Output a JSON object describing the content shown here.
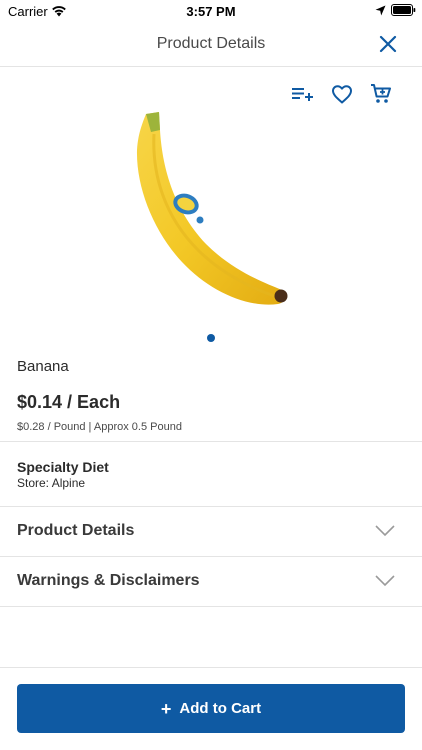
{
  "status_bar": {
    "carrier": "Carrier",
    "time": "3:57 PM"
  },
  "nav": {
    "title": "Product Details",
    "close_icon": "close-icon"
  },
  "actions": {
    "icons": [
      "playlist-add-icon",
      "heart-icon",
      "cart-icon"
    ]
  },
  "product": {
    "name": "Banana",
    "price": "$0.14 / Each",
    "unit_price": "$0.28 / Pound | Approx 0.5 Pound",
    "image_pages": 1,
    "current_image": 1
  },
  "diet": {
    "title": "Specialty Diet",
    "store": "Store: Alpine"
  },
  "sections": [
    {
      "label": "Product Details",
      "icon": "chevron-down-icon"
    },
    {
      "label": "Warnings & Disclaimers",
      "icon": "chevron-down-icon"
    }
  ],
  "cart_button": {
    "icon": "plus-icon",
    "label": "Add to Cart"
  },
  "colors": {
    "accent": "#0f5aa3",
    "text": "#2b2b2b",
    "divider": "#e4e4e4"
  }
}
